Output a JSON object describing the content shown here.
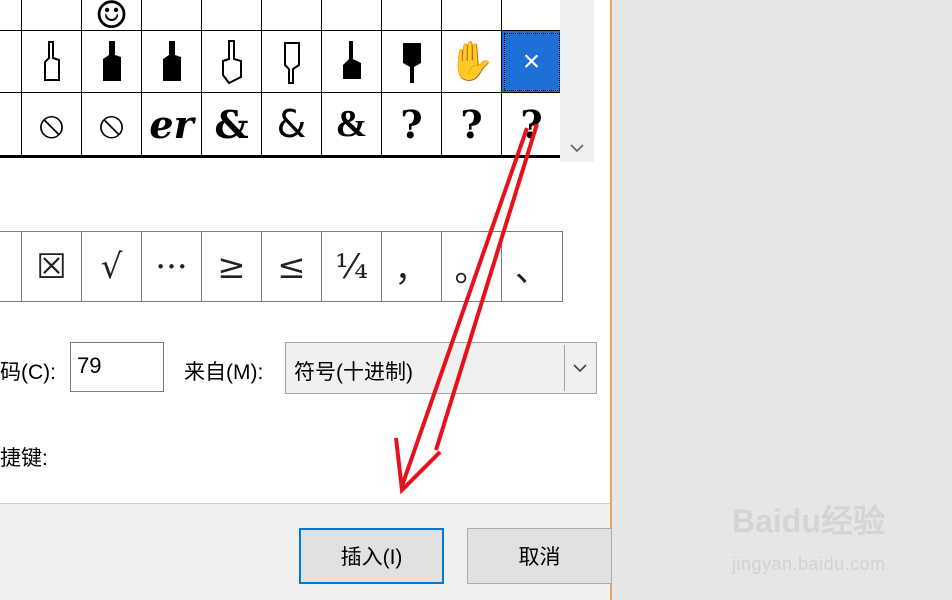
{
  "symbol_grid": {
    "row1": [
      "",
      "",
      "☺",
      "",
      "",
      "",
      "",
      "",
      "",
      ""
    ],
    "row2": [
      "",
      "",
      "",
      "",
      "",
      "",
      "",
      "",
      "✋",
      "×"
    ],
    "row3": [
      "",
      "⦸",
      "⦸",
      "&",
      "&",
      "&",
      "&",
      "?",
      "?",
      "?"
    ]
  },
  "recent_symbols": [
    "",
    "☒",
    "√",
    "···",
    "≥",
    "≤",
    "¼",
    "，",
    "。",
    "、"
  ],
  "char_code": {
    "label": "码(C):",
    "value": "79"
  },
  "from": {
    "label": "来自(M):",
    "value": "符号(十进制)"
  },
  "shortcut_label": "捷键:",
  "buttons": {
    "insert": "插入(I)",
    "cancel": "取消"
  },
  "watermark": {
    "logo": "Baidu经验",
    "url": "jingyan.baidu.com"
  },
  "colors": {
    "accent": "#0078d7",
    "selected_cell": "#1e6fd8",
    "annotation_arrow": "#e8101a",
    "frame": "#e8a55c"
  }
}
